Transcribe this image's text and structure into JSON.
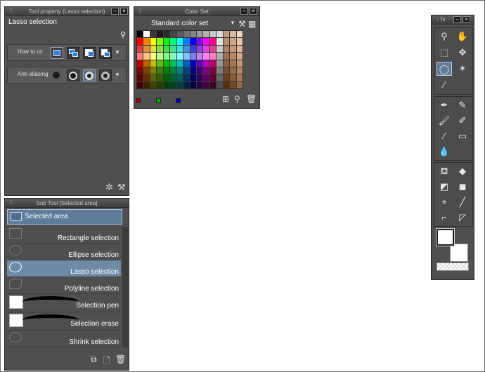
{
  "tool_property": {
    "title": "Tool property (Lasso selection)",
    "tool_name": "Lasso selection",
    "how_to_label": "How to co",
    "anti_alias_label": "Anti-aliasing"
  },
  "sub_tool": {
    "title": "Sub Tool [Selected area]",
    "group_label": "Selected area",
    "items": [
      {
        "label": "Rectangle selection"
      },
      {
        "label": "Ellipse selection"
      },
      {
        "label": "Lasso selection"
      },
      {
        "label": "Polyline selection"
      },
      {
        "label": "Selection pen"
      },
      {
        "label": "Selection erase"
      },
      {
        "label": "Shrink selection"
      }
    ]
  },
  "color_set": {
    "title": "Color Set",
    "set_name": "Standard color set",
    "rows": [
      [
        "#000000",
        "#ffffff",
        "#3a3a3a",
        "#1a1a1a",
        "#2c2c2c",
        "#444444",
        "#5a5a5a",
        "#707070",
        "#868686",
        "#9c9c9c",
        "#b2b2b2",
        "#c8c8c8",
        "#dedede",
        "#c0a080",
        "#d8b898",
        "#f0d8c0"
      ],
      [
        "#ff0000",
        "#ff8000",
        "#ffff00",
        "#80ff00",
        "#00ff00",
        "#00ff80",
        "#00ffff",
        "#0080ff",
        "#0000ff",
        "#8000ff",
        "#ff00ff",
        "#ff0080",
        "#e6e6e6",
        "#b89070",
        "#d0a888",
        "#e8c8a8"
      ],
      [
        "#e04040",
        "#e09040",
        "#e0e040",
        "#90e040",
        "#40e040",
        "#40e090",
        "#40e0e0",
        "#4090e0",
        "#4040e0",
        "#9040e0",
        "#e040e0",
        "#e04090",
        "#cccccc",
        "#a88060",
        "#c89878",
        "#e0b898"
      ],
      [
        "#ff8080",
        "#ffc080",
        "#ffff80",
        "#c0ff80",
        "#80ff80",
        "#80ffc0",
        "#80ffff",
        "#80c0ff",
        "#8080ff",
        "#c080ff",
        "#ff80ff",
        "#ff80c0",
        "#b0b0b0",
        "#987050",
        "#b88868",
        "#d8a888"
      ],
      [
        "#c00000",
        "#c06000",
        "#c0c000",
        "#60c000",
        "#00c000",
        "#00c060",
        "#00c0c0",
        "#0060c0",
        "#0000c0",
        "#6000c0",
        "#c000c0",
        "#c00060",
        "#999999",
        "#886040",
        "#a87858",
        "#c89878"
      ],
      [
        "#800000",
        "#804000",
        "#808000",
        "#408000",
        "#008000",
        "#008040",
        "#008080",
        "#004080",
        "#000080",
        "#400080",
        "#800080",
        "#800040",
        "#808080",
        "#785030",
        "#986848",
        "#b88868"
      ],
      [
        "#600000",
        "#603000",
        "#606000",
        "#306000",
        "#006000",
        "#006030",
        "#006060",
        "#003060",
        "#000060",
        "#300060",
        "#600060",
        "#600030",
        "#666666",
        "#684020",
        "#885838",
        "#a87858"
      ],
      [
        "#400000",
        "#402000",
        "#404000",
        "#204000",
        "#004000",
        "#004020",
        "#004040",
        "#002040",
        "#000040",
        "#200040",
        "#400040",
        "#400020",
        "#4d4d4d",
        "#583010",
        "#784828",
        "#986848"
      ]
    ],
    "mini_swatches": [
      "#b00000",
      "#00b000",
      "#0000b0"
    ]
  },
  "tool_palette": {
    "title": "To"
  }
}
